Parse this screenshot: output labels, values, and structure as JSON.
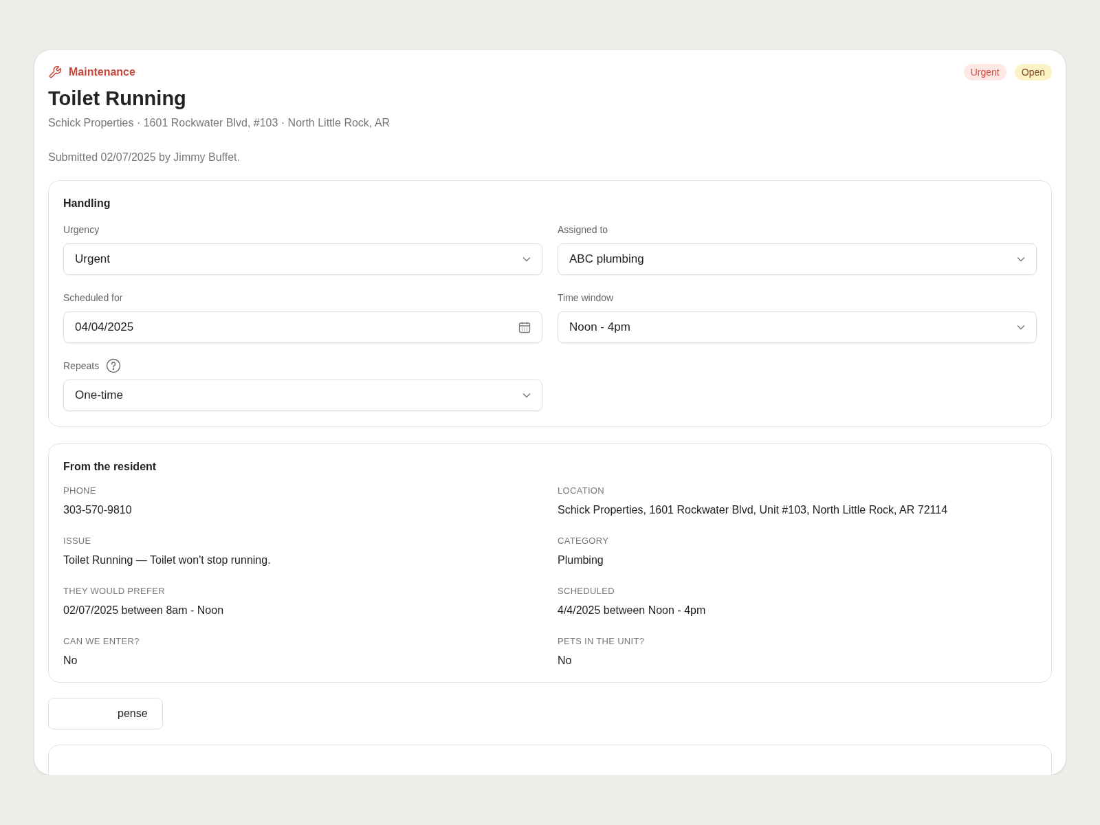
{
  "header": {
    "category": "Maintenance",
    "title": "Toilet Running",
    "address": "Schick Properties · 1601 Rockwater Blvd, #103 · North Little Rock, AR",
    "submitted": "Submitted 02/07/2025 by Jimmy Buffet.",
    "badges": [
      {
        "label": "Urgent",
        "kind": "urgent"
      },
      {
        "label": "Open",
        "kind": "open"
      }
    ]
  },
  "handling": {
    "title": "Handling",
    "fields": [
      {
        "label": "Urgency",
        "value": "Urgent",
        "kind": "select"
      },
      {
        "label": "Assigned to",
        "value": "ABC plumbing",
        "kind": "select"
      },
      {
        "label": "Scheduled for",
        "value": "04/04/2025",
        "kind": "date"
      },
      {
        "label": "Time window",
        "value": "Noon - 4pm",
        "kind": "select"
      },
      {
        "label": "Repeats",
        "value": "One-time",
        "kind": "select",
        "help": true
      }
    ]
  },
  "resident": {
    "title": "From the resident",
    "items": [
      {
        "label": "PHONE",
        "value": "303-570-9810"
      },
      {
        "label": "LOCATION",
        "value": "Schick Properties, 1601 Rockwater Blvd, Unit #103, North Little Rock, AR 72114"
      },
      {
        "label": "ISSUE",
        "value": "Toilet Running — Toilet won't stop running."
      },
      {
        "label": "CATEGORY",
        "value": "Plumbing"
      },
      {
        "label": "THEY WOULD PREFER",
        "value": "02/07/2025 between 8am - Noon"
      },
      {
        "label": "SCHEDULED",
        "value": "4/4/2025 between Noon - 4pm"
      },
      {
        "label": "CAN WE ENTER?",
        "value": "No"
      },
      {
        "label": "PETS IN THE UNIT?",
        "value": "No"
      }
    ]
  },
  "expense_button": {
    "label": "pense"
  }
}
